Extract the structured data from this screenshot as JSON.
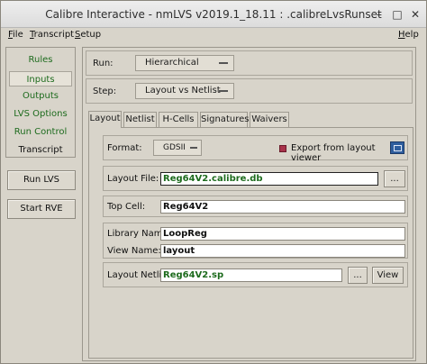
{
  "window": {
    "title": "Calibre Interactive - nmLVS v2019.1_18.11 : .calibreLvsRunset"
  },
  "menubar": {
    "file": {
      "u": "F",
      "rest": "ile"
    },
    "transcript": {
      "u": "T",
      "rest": "ranscript"
    },
    "setup": {
      "u": "S",
      "rest": "etup"
    },
    "help": {
      "u": "H",
      "rest": "elp"
    }
  },
  "sidebar": {
    "items": [
      {
        "label": "Rules"
      },
      {
        "label": "Inputs"
      },
      {
        "label": "Outputs"
      },
      {
        "label": "LVS Options"
      },
      {
        "label": "Run Control"
      },
      {
        "label": "Transcript"
      }
    ],
    "run_lvs": "Run LVS",
    "start_rve": "Start RVE"
  },
  "run": {
    "label": "Run:",
    "value": "Hierarchical"
  },
  "step": {
    "label": "Step:",
    "value": "Layout vs Netlist"
  },
  "tabs": [
    "Layout",
    "Netlist",
    "H-Cells",
    "Signatures",
    "Waivers"
  ],
  "layout": {
    "format_label": "Format:",
    "format_value": "GDSII",
    "export_label": "Export from layout viewer",
    "layout_file_label": "Layout File:",
    "layout_file_value": "Reg64V2.calibre.db",
    "browse": "...",
    "top_cell_label": "Top Cell:",
    "top_cell_value": "Reg64V2",
    "library_name_label": "Library Name:",
    "library_name_value": "LoopReg",
    "view_name_label": "View Name:",
    "view_name_value": "layout",
    "layout_netlist_label": "Layout Netlist:",
    "layout_netlist_value": "Reg64V2.sp",
    "view_button": "View"
  }
}
